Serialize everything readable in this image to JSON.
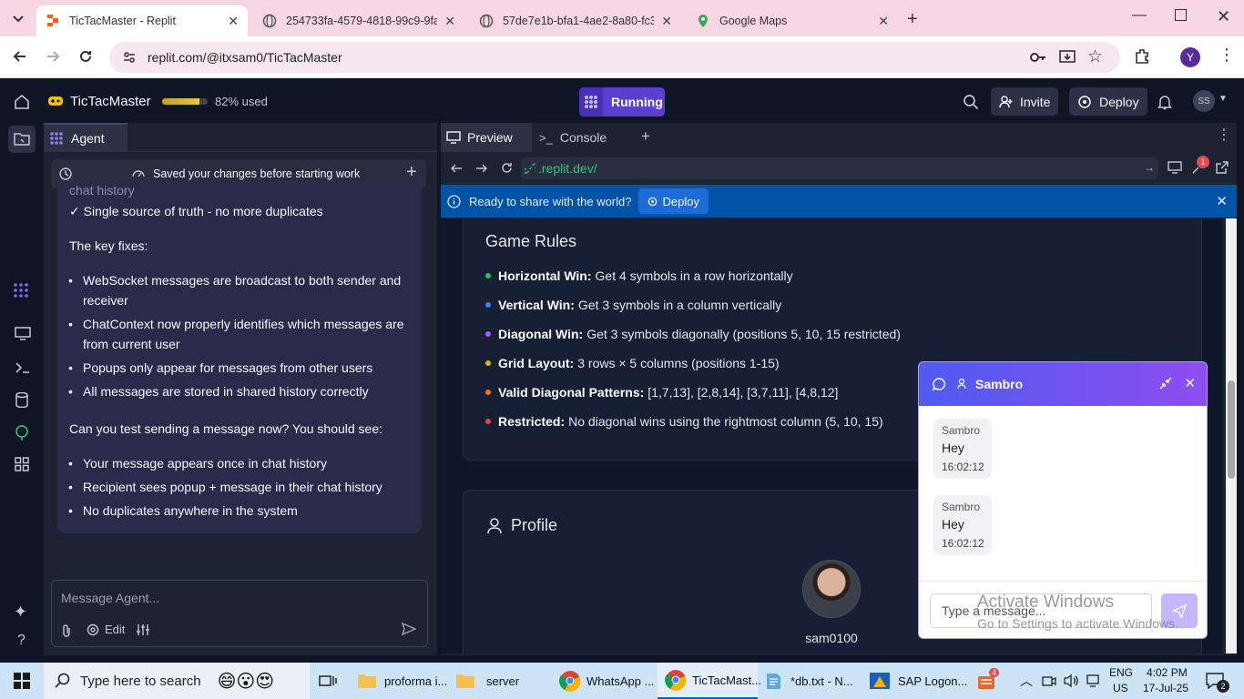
{
  "browser": {
    "tabs": [
      {
        "title": "TicTacMaster - Replit",
        "active": true
      },
      {
        "title": "254733fa-4579-4818-99c9-9fab"
      },
      {
        "title": "57de7e1b-bfa1-4ae2-8a80-fc3("
      },
      {
        "title": "Google Maps"
      }
    ],
    "url": "replit.com/@itxsam0/TicTacMaster",
    "profile_initial": "Y"
  },
  "replit": {
    "project_name": "TicTacMaster",
    "usage_label": "82% used",
    "usage_fraction": 0.82,
    "run_status": "Running",
    "invite_label": "Invite",
    "deploy_label": "Deploy",
    "avatar_initials": "SS"
  },
  "agent": {
    "tab_label": "Agent",
    "saved_notice": "Saved your changes before starting work",
    "partial_line": "chat history",
    "check_line": "✓ Single source of truth - no more duplicates",
    "key_fixes_heading": "The key fixes:",
    "fixes": [
      "WebSocket messages are broadcast to both sender and receiver",
      "ChatContext now properly identifies which messages are from current user",
      "Popups only appear for messages from other users",
      "All messages are stored in shared history correctly"
    ],
    "test_prompt": "Can you test sending a message now? You should see:",
    "expectations": [
      "Your message appears once in chat history",
      "Recipient sees popup + message in their chat history",
      "No duplicates anywhere in the system"
    ],
    "input_placeholder": "Message Agent...",
    "edit_label": "Edit"
  },
  "preview": {
    "tabs": [
      "Preview",
      "Console"
    ],
    "url": ".replit.dev/",
    "badge_count": "1",
    "banner_text": "Ready to share with the world?",
    "banner_button": "Deploy",
    "rules_title": "Game Rules",
    "rules": [
      {
        "label": "Horizontal Win:",
        "text": "Get 4 symbols in a row horizontally",
        "color": "#22c55e"
      },
      {
        "label": "Vertical Win:",
        "text": "Get 3 symbols in a column vertically",
        "color": "#3b82f6"
      },
      {
        "label": "Diagonal Win:",
        "text": "Get 3 symbols diagonally (positions 5, 10, 15 restricted)",
        "color": "#a855f7"
      },
      {
        "label": "Grid Layout:",
        "text": "3 rows × 5 columns (positions 1-15)",
        "color": "#eab308"
      },
      {
        "label": "Valid Diagonal Patterns:",
        "text": "[1,7,13], [2,8,14], [3,7,11], [4,8,12]",
        "color": "#f97316"
      },
      {
        "label": "Restricted:",
        "text": "No diagonal wins using the rightmost column (5, 10, 15)",
        "color": "#ef4444"
      }
    ],
    "profile_title": "Profile",
    "profile_username": "sam0100"
  },
  "chat": {
    "title": "Sambro",
    "messages": [
      {
        "sender": "Sambro",
        "text": "Hey",
        "time": "16:02:12"
      },
      {
        "sender": "Sambro",
        "text": "Hey",
        "time": "16:02:12"
      }
    ],
    "input_placeholder": "Type a message...",
    "watermark_title": "Activate Windows",
    "watermark_sub": "Go to Settings to activate Windows."
  },
  "taskbar": {
    "search_placeholder": "Type here to search",
    "apps": [
      "proforma i...",
      "server",
      "WhatsApp ...",
      "TicTacMast...",
      "*db.txt - N...",
      "SAP Logon..."
    ],
    "lang": "ENG",
    "region": "US",
    "time": "4:02 PM",
    "date": "17-Jul-25",
    "notif_count": "2",
    "tray_badge": "4"
  }
}
